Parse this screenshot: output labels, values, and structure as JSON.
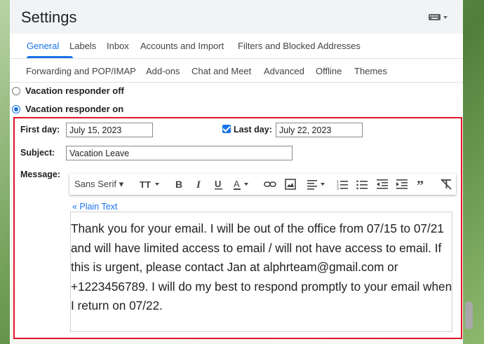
{
  "window": {
    "title": "Settings",
    "keyboard_icon": "keyboard-icon"
  },
  "tabs_row1": [
    {
      "label": "General",
      "active": true
    },
    {
      "label": "Labels"
    },
    {
      "label": "Inbox"
    },
    {
      "label": "Accounts and Import"
    },
    {
      "label": "Filters and Blocked Addresses"
    }
  ],
  "tabs_row2": [
    {
      "label": "Forwarding and POP/IMAP"
    },
    {
      "label": "Add-ons"
    },
    {
      "label": "Chat and Meet"
    },
    {
      "label": "Advanced"
    },
    {
      "label": "Offline"
    },
    {
      "label": "Themes"
    }
  ],
  "vacation": {
    "off_label": "Vacation responder off",
    "on_label": "Vacation responder on",
    "selected": "on"
  },
  "form": {
    "first_day_label": "First day:",
    "first_day_value": "July 15, 2023",
    "last_day_label": "Last day:",
    "last_day_checked": true,
    "last_day_value": "July 22, 2023",
    "subject_label": "Subject:",
    "subject_value": "Vacation Leave",
    "message_label": "Message:"
  },
  "toolbar": {
    "font": "Sans Serif",
    "icons": [
      "text-size-icon",
      "bold-icon",
      "italic-icon",
      "underline-icon",
      "text-color-icon",
      "link-icon",
      "image-icon",
      "align-icon",
      "numbered-list-icon",
      "bulleted-list-icon",
      "indent-less-icon",
      "indent-more-icon",
      "quote-icon",
      "remove-formatting-icon"
    ]
  },
  "plain_text_link": "« Plain Text",
  "message_body": "Thank you for your email. I will be out of the office from 07/15 to 07/21 and will have limited access to email / will not have access to email. If this is urgent, please contact Jan at alphrteam@gmail.com or +1223456789. I will do my best to respond promptly to your email when I return on 07/22.",
  "colors": {
    "accent": "#1a73e8",
    "highlight_border": "#e0162b"
  }
}
